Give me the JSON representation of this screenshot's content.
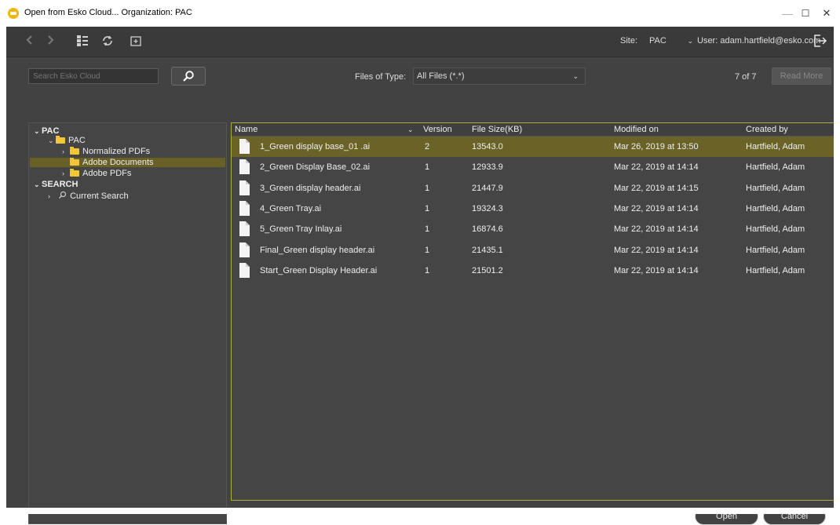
{
  "window": {
    "title": "Open from Esko Cloud... Organization: PAC",
    "minimize_glyph": "—",
    "maximize_glyph": "☐",
    "close_glyph": "✕"
  },
  "toolbar": {
    "back_icon": "chevron-left-icon",
    "forward_icon": "chevron-right-icon",
    "view_icon": "list-view-icon",
    "refresh_icon": "refresh-icon",
    "new_folder_icon": "new-folder-icon",
    "site_label": "Site:",
    "site_value": "PAC",
    "user_label": "User: adam.hartfield@esko.com",
    "logout_icon": "logout-icon"
  },
  "search": {
    "placeholder": "Search Esko Cloud",
    "button_icon": "search-icon"
  },
  "filter": {
    "label": "Files of Type:",
    "value": "All Files (*.*)",
    "count": "7 of 7",
    "read_more": "Read More"
  },
  "tree": {
    "root": "PAC",
    "folder": "PAC",
    "items": [
      {
        "label": "Normalized PDFs"
      },
      {
        "label": "Adobe Documents"
      },
      {
        "label": "Adobe PDFs"
      }
    ],
    "search_section": "SEARCH",
    "current_search": "Current Search"
  },
  "table": {
    "columns": [
      "Name",
      "Version",
      "File Size(KB)",
      "Modified on",
      "Created by"
    ],
    "rows": [
      {
        "name": "1_Green display base_01 .ai",
        "version": "2",
        "size": "13543.0",
        "modified": "Mar 26, 2019 at 13:50",
        "created_by": "Hartfield, Adam"
      },
      {
        "name": "2_Green Display Base_02.ai",
        "version": "1",
        "size": "12933.9",
        "modified": "Mar 22, 2019 at 14:14",
        "created_by": "Hartfield, Adam"
      },
      {
        "name": "3_Green display header.ai",
        "version": "1",
        "size": "21447.9",
        "modified": "Mar 22, 2019 at 14:15",
        "created_by": "Hartfield, Adam"
      },
      {
        "name": "4_Green Tray.ai",
        "version": "1",
        "size": "19324.3",
        "modified": "Mar 22, 2019 at 14:14",
        "created_by": "Hartfield, Adam"
      },
      {
        "name": "5_Green Tray Inlay.ai",
        "version": "1",
        "size": "16874.6",
        "modified": "Mar 22, 2019 at 14:14",
        "created_by": "Hartfield, Adam"
      },
      {
        "name": "Final_Green display header.ai",
        "version": "1",
        "size": "21435.1",
        "modified": "Mar 22, 2019 at 14:14",
        "created_by": "Hartfield, Adam"
      },
      {
        "name": "Start_Green Display Header.ai",
        "version": "1",
        "size": "21501.2",
        "modified": "Mar 22, 2019 at 14:14",
        "created_by": "Hartfield, Adam"
      }
    ]
  },
  "actions": {
    "open": "Open",
    "cancel": "Cancel"
  },
  "colors": {
    "background": "#424242",
    "selection": "#6b6228",
    "panel_border_accent": "#b3aa3e",
    "folder": "#f3c63a"
  }
}
